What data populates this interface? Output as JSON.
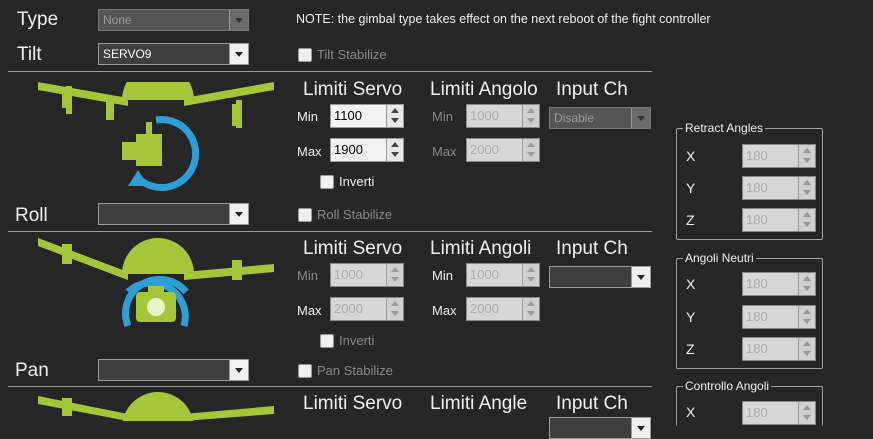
{
  "type": {
    "label": "Type",
    "value": "None"
  },
  "note": "NOTE: the gimbal type takes effect on the next reboot of the fight controller",
  "tilt": {
    "label": "Tilt",
    "value": "SERVO9",
    "stabilize": "Tilt Stabilize",
    "head_servo": "Limiti Servo",
    "head_angle": "Limiti Angolo",
    "head_input": "Input Ch",
    "min_label": "Min",
    "max_label": "Max",
    "servo_min": "1100",
    "servo_max": "1900",
    "angle_min": "1000",
    "angle_max": "2000",
    "input": "Disable",
    "invert": "Inverti"
  },
  "roll": {
    "label": "Roll",
    "value": "",
    "stabilize": "Roll Stabilize",
    "head_servo": "Limiti Servo",
    "head_angle": "Limiti Angoli",
    "head_input": "Input Ch",
    "min_label": "Min",
    "max_label": "Max",
    "servo_min": "1000",
    "servo_max": "2000",
    "angle_min": "1000",
    "angle_max": "2000",
    "input": "",
    "invert": "Inverti"
  },
  "pan": {
    "label": "Pan",
    "value": "",
    "stabilize": "Pan Stabilize",
    "head_servo": "Limiti Servo",
    "head_angle": "Limiti Angle",
    "head_input": "Input Ch"
  },
  "retract": {
    "title": "Retract Angles",
    "x_label": "X",
    "y_label": "Y",
    "z_label": "Z",
    "x": "180",
    "y": "180",
    "z": "180"
  },
  "neutral": {
    "title": "Angoli Neutri",
    "x_label": "X",
    "y_label": "Y",
    "z_label": "Z",
    "x": "180",
    "y": "180",
    "z": "180"
  },
  "control": {
    "title": "Controllo Angoli",
    "x_label": "X",
    "x": "180"
  },
  "colors": {
    "drone_green": "#a4c639",
    "arrow_blue": "#2e9fd6",
    "background": "#262626"
  }
}
